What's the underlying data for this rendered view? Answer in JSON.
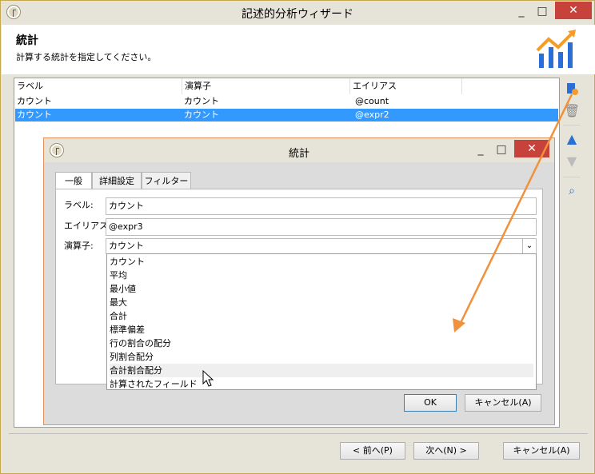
{
  "window": {
    "title": "記述的分析ウィザード"
  },
  "header": {
    "title": "統計",
    "subtitle": "計算する統計を指定してください。"
  },
  "list": {
    "columns": [
      "ラベル",
      "演算子",
      "エイリアス"
    ],
    "rows": [
      {
        "label": "カウント",
        "operator": "カウント",
        "alias": "@count"
      },
      {
        "label": "カウント",
        "operator": "カウント",
        "alias": "@expr2"
      }
    ]
  },
  "dialog": {
    "title": "統計",
    "tabs": [
      "一般",
      "詳細設定",
      "フィルター"
    ],
    "label_caption": "ラベル:",
    "label_value": "カウント",
    "alias_caption": "エイリアス:",
    "alias_value": "@expr3",
    "operator_caption": "演算子:",
    "operator_value": "カウント",
    "operator_options": [
      "カウント",
      "平均",
      "最小値",
      "最大",
      "合計",
      "標準偏差",
      "行の割合の配分",
      "列割合配分",
      "合計割合配分",
      "計算されたフィールド"
    ],
    "ok_label": "OK",
    "cancel_label": "キャンセル(A)"
  },
  "footer": {
    "prev_label": "< 前へ(P)",
    "next_label": "次へ(N) >",
    "cancel_label": "キャンセル(A)"
  },
  "colors": {
    "selection": "#3399ff",
    "close": "#c7423a",
    "accent_arrow": "#f0913b",
    "chart_icon_blue": "#2b6fd6",
    "chart_icon_orange": "#f39c2a"
  }
}
